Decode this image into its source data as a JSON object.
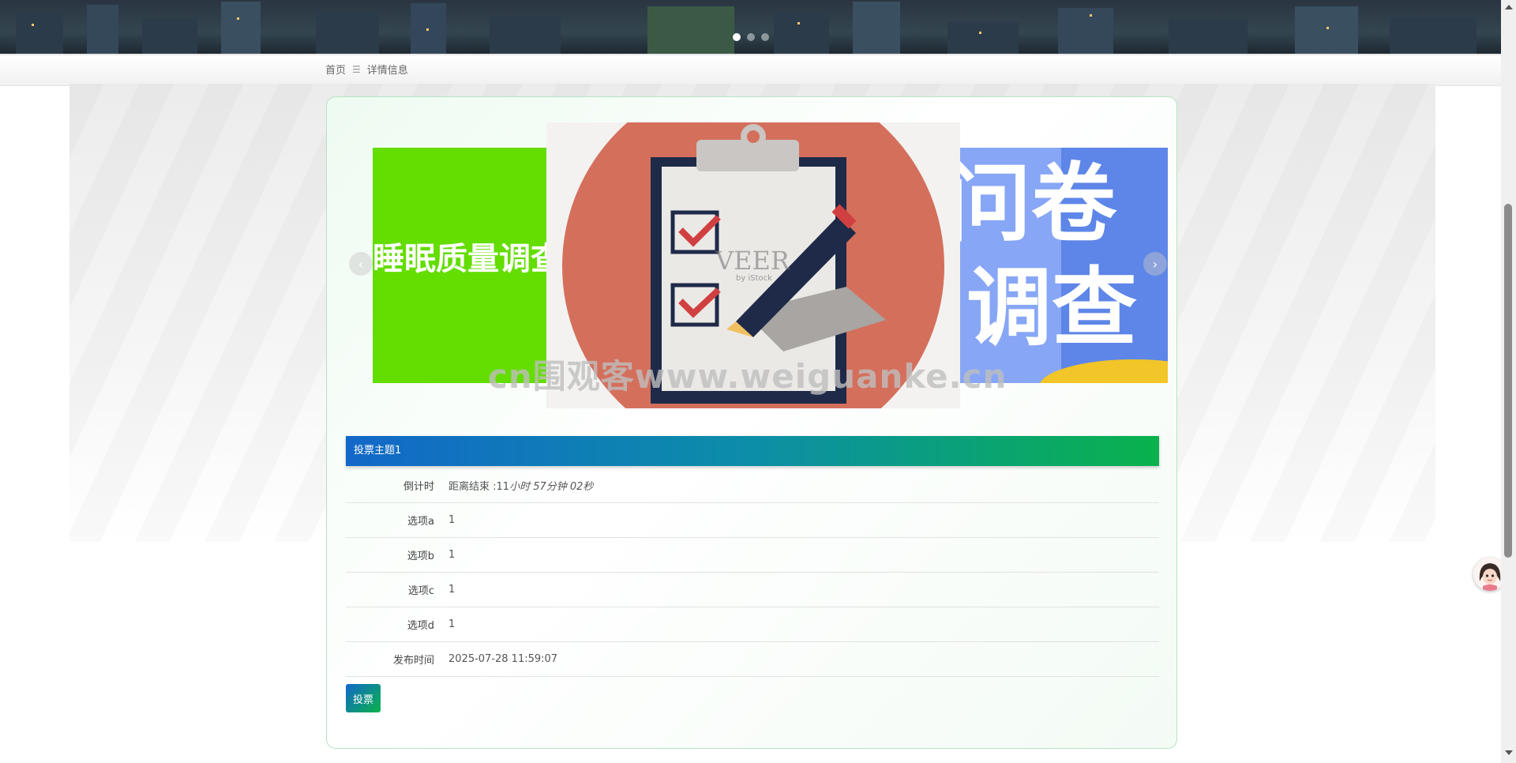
{
  "banner": {
    "slides_count": 3,
    "active_slide": 1
  },
  "breadcrumb": {
    "home": "首页",
    "separator": "☰",
    "current": "详情信息"
  },
  "carousel": {
    "left_slide_text": "睡眠质量调查",
    "center_slide_text": "VEER",
    "center_slide_subtext": "by iStock",
    "right_slide_line1": "问卷",
    "right_slide_line2": "调查",
    "watermark": "cn围观客www.weiguanke.cn",
    "prev_label": "‹",
    "next_label": "›"
  },
  "detail": {
    "title": "投票主题1",
    "rows": [
      {
        "label": "倒计时",
        "value_prefix": "距离结束 :11",
        "value_italic": "小时 57分钟 02秒"
      },
      {
        "label": "选项a",
        "value": "1"
      },
      {
        "label": "选项b",
        "value": "1"
      },
      {
        "label": "选项c",
        "value": "1"
      },
      {
        "label": "选项d",
        "value": "1"
      },
      {
        "label": "发布时间",
        "value": "2025-07-28 11:59:07"
      }
    ],
    "vote_button": "投票"
  },
  "colors": {
    "header_gradient_start": "#1268c8",
    "header_gradient_end": "#09b24c",
    "card_border": "#b7e3c5",
    "left_slide_bg": "#64dd00",
    "right_slide_bg": "#87a6f5"
  }
}
